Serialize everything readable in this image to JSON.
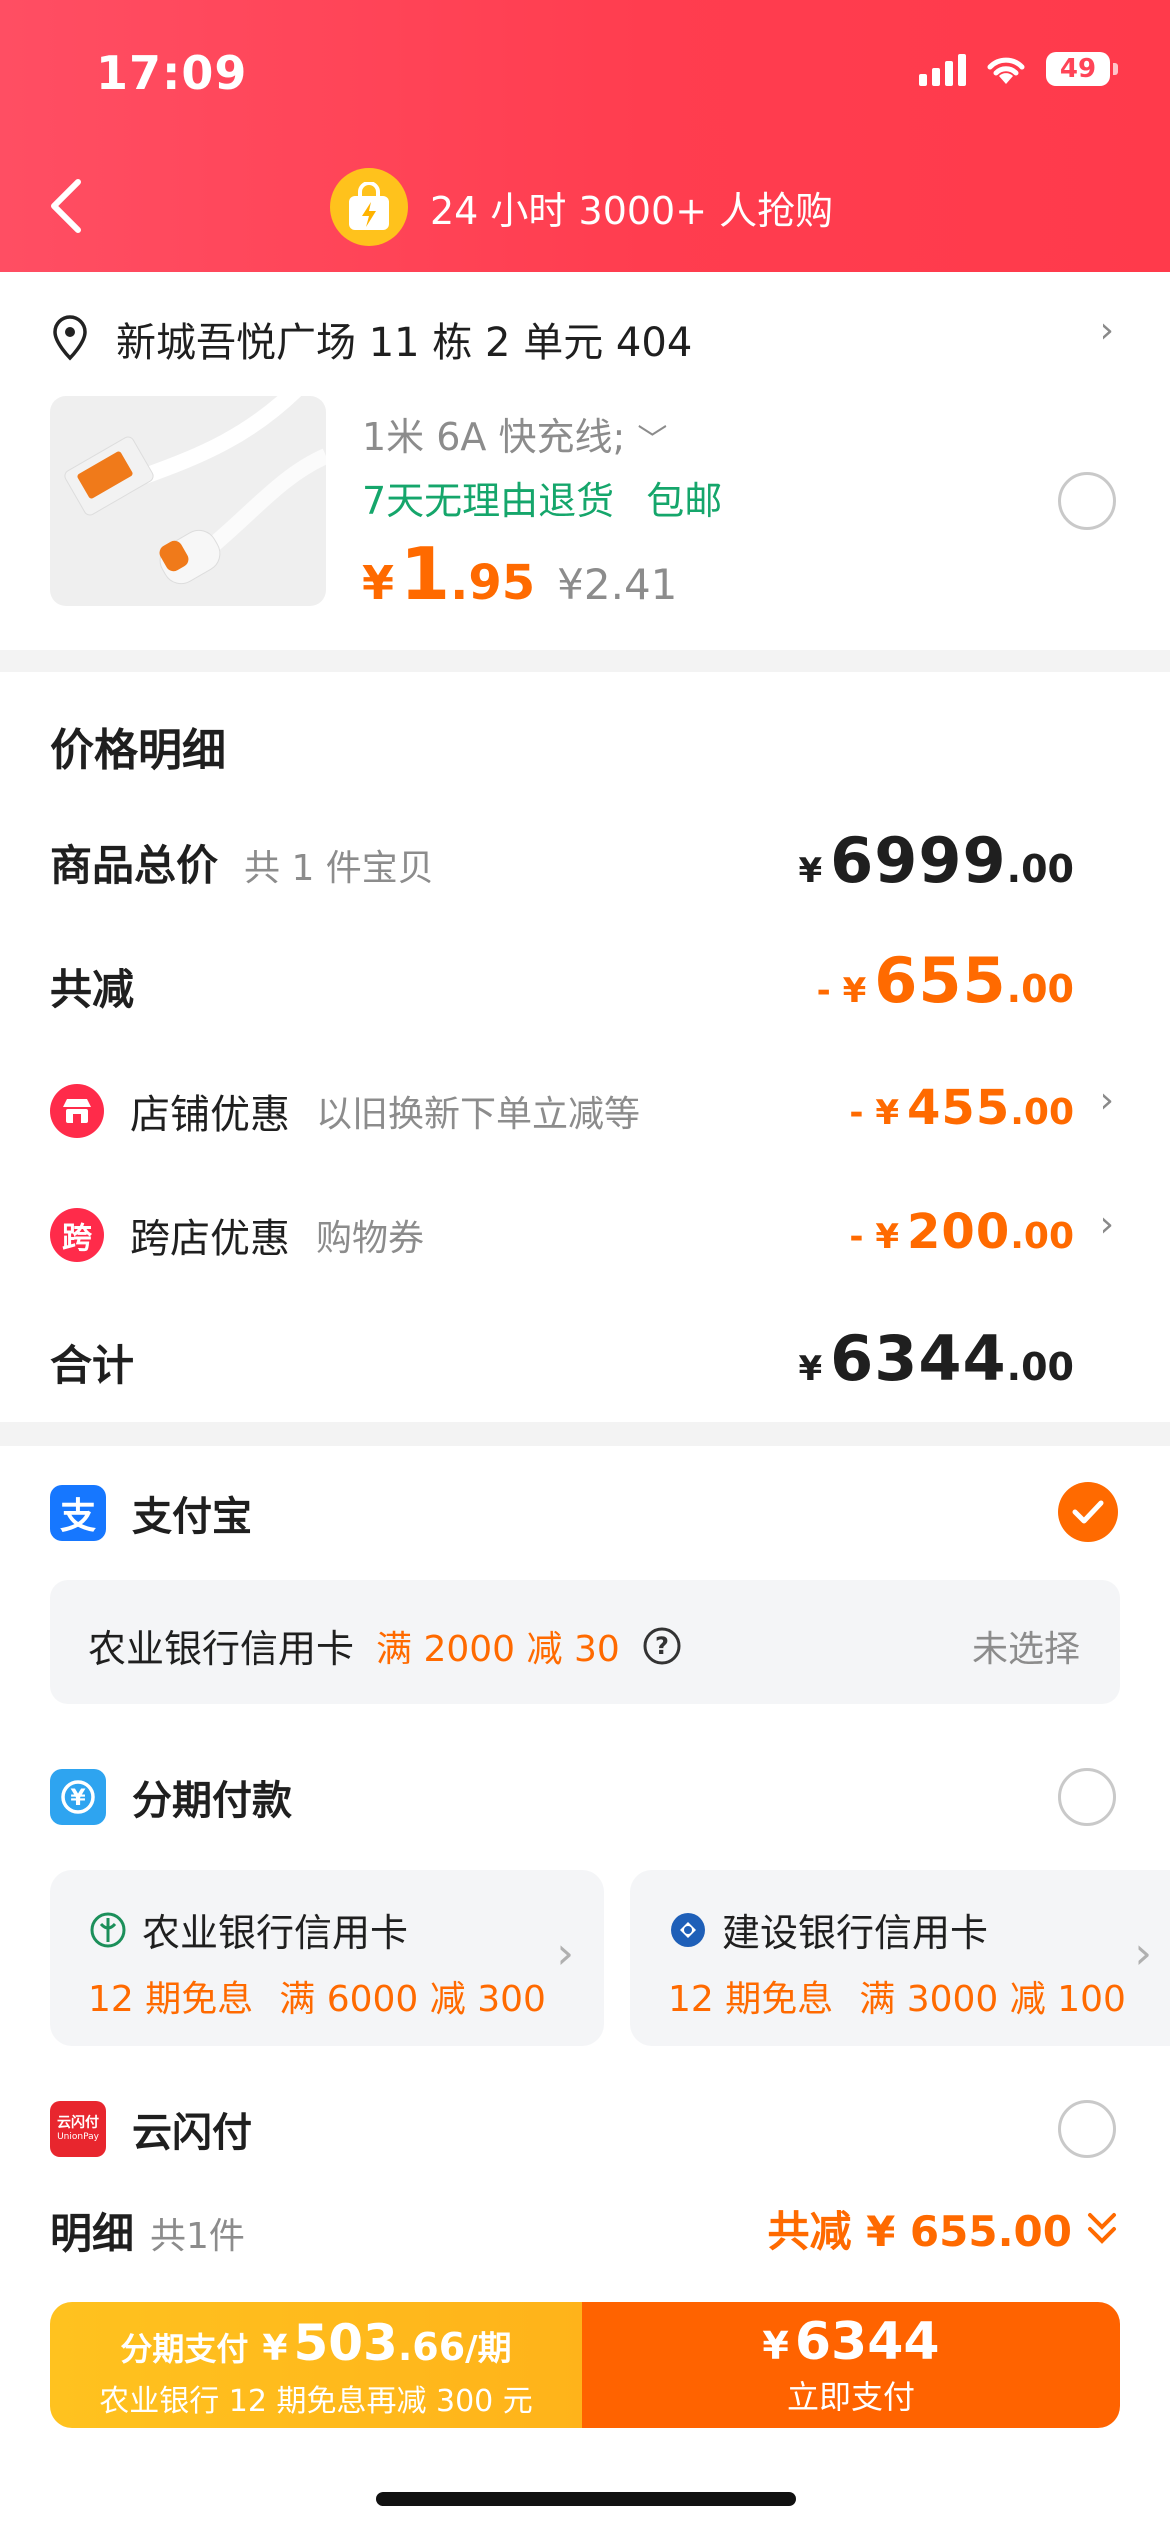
{
  "status": {
    "time": "17:09",
    "battery": "49"
  },
  "header": {
    "title": "24 小时 3000+ 人抢购"
  },
  "address": {
    "text": "新城吾悦广场 11 栋 2 单元 404"
  },
  "product": {
    "spec": "1米 6A 快充线;",
    "tags": [
      "7天无理由退货",
      "包邮"
    ],
    "price_symbol": "¥",
    "price_int": "1",
    "price_dec": ".95",
    "original_price": "¥2.41"
  },
  "price_detail": {
    "title": "价格明细",
    "total": {
      "label": "商品总价",
      "sub": "共 1 件宝贝",
      "cur": "¥",
      "int": "6999",
      "dec": ".00"
    },
    "reduce": {
      "label": "共减",
      "cur": "- ¥",
      "int": "655",
      "dec": ".00"
    },
    "shop": {
      "icon": "shop-icon",
      "label": "店铺优惠",
      "sub": "以旧换新下单立减等",
      "cur": "- ¥",
      "int": "455",
      "dec": ".00"
    },
    "cross": {
      "icon_text": "跨",
      "label": "跨店优惠",
      "sub": "购物券",
      "cur": "- ¥",
      "int": "200",
      "dec": ".00"
    },
    "sum": {
      "label": "合计",
      "cur": "¥",
      "int": "6344",
      "dec": ".00"
    }
  },
  "payment": {
    "alipay": {
      "icon_text": "支",
      "label": "支付宝",
      "selected": true
    },
    "alipay_card": {
      "bank": "农业银行信用卡",
      "promo": "满 2000 减 30",
      "status": "未选择"
    },
    "installment": {
      "label": "分期付款"
    },
    "bank1": {
      "name": "农业银行信用卡",
      "terms": "12 期免息",
      "promo": "满 6000 减 300"
    },
    "bank2": {
      "name": "建设银行信用卡",
      "terms": "12 期免息",
      "promo": "满 3000 减 100"
    },
    "unionpay": {
      "label": "云闪付",
      "icon_text": "云闪付",
      "icon_sub": "UnionPay"
    }
  },
  "summary": {
    "label": "明细",
    "count": "共1件",
    "reduce": "共减 ¥ 655.00"
  },
  "paybar": {
    "left_prefix": "分期支付",
    "left_cur": "¥",
    "left_int": "503",
    "left_dec": ".66",
    "left_unit": "/期",
    "left_sub": "农业银行 12 期免息再减 300 元",
    "right_cur": "¥",
    "right_amount": "6344",
    "right_label": "立即支付"
  },
  "colors": {
    "brand_red": "#ff4457",
    "accent_orange": "#ff6a00",
    "alipay_blue": "#1677ff",
    "green": "#15a66b"
  }
}
